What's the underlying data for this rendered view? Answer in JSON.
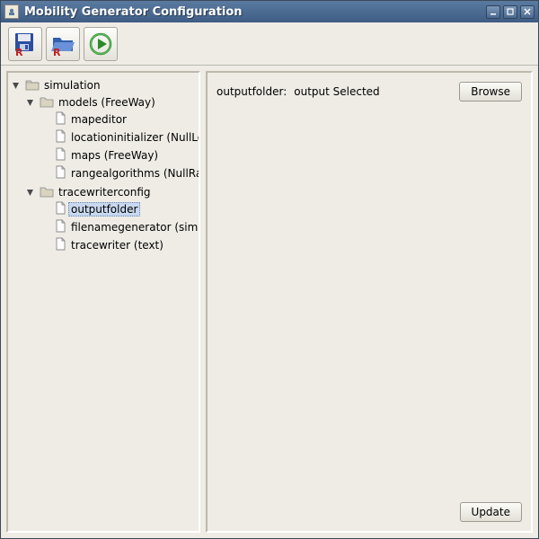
{
  "window": {
    "title": "Mobility Generator Configuration"
  },
  "toolbar": {
    "saveR": "R",
    "openR": "R"
  },
  "tree": {
    "root": "simulation",
    "models": {
      "label": "models (FreeWay)",
      "children": {
        "mapeditor": "mapeditor",
        "locationinitializer": "locationinitializer (NullLocationInitializer)",
        "maps": "maps (FreeWay)",
        "rangealgorithms": "rangealgorithms (NullRangeAlgorithm)"
      }
    },
    "tracewriter": {
      "label": "tracewriterconfig",
      "children": {
        "outputfolder": "outputfolder",
        "filenamegenerator": "filenamegenerator (simpleFilenameGenerator)",
        "tracewriter": "tracewriter (text)"
      }
    }
  },
  "detail": {
    "field_label": "outputfolder:",
    "field_value": "output Selected",
    "browse_label": "Browse",
    "update_label": "Update"
  }
}
